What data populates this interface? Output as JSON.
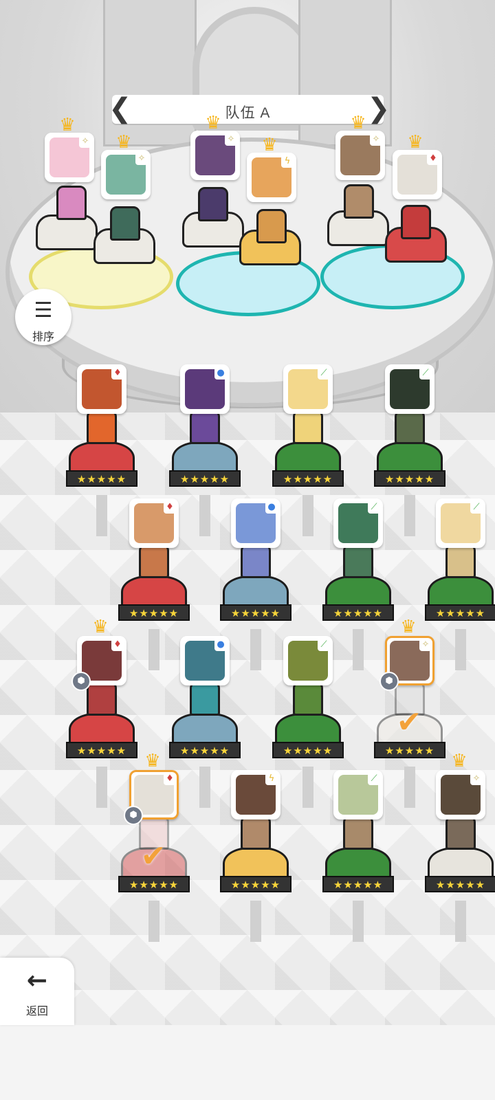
{
  "team": {
    "title": "队伍 A",
    "prev_arrow": "❮",
    "next_arrow": "❯"
  },
  "sort": {
    "label": "排序",
    "icon": "sort-icon"
  },
  "back": {
    "label": "返回",
    "icon": "back-arrow-icon"
  },
  "stars_text": "★★★★★",
  "check_glyph": "✔",
  "crown_glyph": "♛",
  "team_slots": [
    {
      "element": "✧",
      "element_color": "#c9b86a",
      "face": "#f5c6d6",
      "sprite": "#d98ac0",
      "pedestal": "white"
    },
    {
      "element": "✧",
      "element_color": "#c9b86a",
      "face": "#7ab5a1",
      "sprite": "#3f6b5b",
      "pedestal": "white"
    },
    {
      "element": "✧",
      "element_color": "#c9b86a",
      "face": "#6a4a7c",
      "sprite": "#4b3b6b",
      "pedestal": "white"
    },
    {
      "element": "ϟ",
      "element_color": "#e4b52c",
      "face": "#e7a55c",
      "sprite": "#d89a4d",
      "pedestal": "gold"
    },
    {
      "element": "✧",
      "element_color": "#c9b86a",
      "face": "#9a7a5e",
      "sprite": "#b08c6a",
      "pedestal": "white"
    },
    {
      "element": "♦",
      "element_color": "#d04040",
      "face": "#e4e0d8",
      "sprite": "#c43c3c",
      "pedestal": "red"
    }
  ],
  "roster": [
    {
      "element": "♦",
      "element_color": "#d04040",
      "face": "#c2562f",
      "sprite": "#e2662c",
      "pedestal": "red",
      "crown": false,
      "selected": false,
      "gear": false,
      "check": false
    },
    {
      "element": "●",
      "element_color": "#3a7fe0",
      "face": "#5b3a7a",
      "sprite": "#6b4a9a",
      "pedestal": "blue",
      "crown": false,
      "selected": false,
      "gear": false,
      "check": false
    },
    {
      "element": "⟋",
      "element_color": "#4caf50",
      "face": "#f3d88c",
      "sprite": "#efd37a",
      "pedestal": "green",
      "crown": false,
      "selected": false,
      "gear": false,
      "check": false
    },
    {
      "element": "⟋",
      "element_color": "#4caf50",
      "face": "#2d3a2d",
      "sprite": "#5a6a4a",
      "pedestal": "green",
      "crown": false,
      "selected": false,
      "gear": false,
      "check": false
    },
    {
      "element": "♦",
      "element_color": "#d04040",
      "face": "#d89a6a",
      "sprite": "#c8784a",
      "pedestal": "red",
      "crown": false,
      "selected": false,
      "gear": false,
      "check": false
    },
    {
      "element": "●",
      "element_color": "#3a7fe0",
      "face": "#7a98d8",
      "sprite": "#7a86c8",
      "pedestal": "blue",
      "crown": false,
      "selected": false,
      "gear": false,
      "check": false
    },
    {
      "element": "⟋",
      "element_color": "#4caf50",
      "face": "#3f7a5a",
      "sprite": "#4a7a5a",
      "pedestal": "green",
      "crown": false,
      "selected": false,
      "gear": false,
      "check": false
    },
    {
      "element": "⟋",
      "element_color": "#4caf50",
      "face": "#f0d8a0",
      "sprite": "#d8c08a",
      "pedestal": "green",
      "crown": false,
      "selected": false,
      "gear": false,
      "check": false
    },
    {
      "element": "♦",
      "element_color": "#d04040",
      "face": "#7a3a3a",
      "sprite": "#b04040",
      "pedestal": "red",
      "crown": true,
      "selected": false,
      "gear": true,
      "check": false
    },
    {
      "element": "●",
      "element_color": "#3a7fe0",
      "face": "#3f7a8a",
      "sprite": "#3a9aa0",
      "pedestal": "blue",
      "crown": false,
      "selected": false,
      "gear": false,
      "check": false
    },
    {
      "element": "⟋",
      "element_color": "#4caf50",
      "face": "#7a8a3a",
      "sprite": "#5a8a3a",
      "pedestal": "green",
      "crown": false,
      "selected": false,
      "gear": false,
      "check": false
    },
    {
      "element": "✧",
      "element_color": "#c9b86a",
      "face": "#8a6a5a",
      "sprite": "#d8d8d8",
      "pedestal": "white",
      "crown": true,
      "selected": true,
      "gear": true,
      "check": true
    },
    {
      "element": "♦",
      "element_color": "#d04040",
      "face": "#e4e0d8",
      "sprite": "#e8b0b0",
      "pedestal": "red",
      "crown": true,
      "selected": true,
      "gear": true,
      "check": true
    },
    {
      "element": "ϟ",
      "element_color": "#e4b52c",
      "face": "#6a4a3a",
      "sprite": "#b08a6a",
      "pedestal": "gold",
      "crown": false,
      "selected": false,
      "gear": false,
      "check": false
    },
    {
      "element": "⟋",
      "element_color": "#4caf50",
      "face": "#b8c89a",
      "sprite": "#a88a6a",
      "pedestal": "green",
      "crown": false,
      "selected": false,
      "gear": false,
      "check": false
    },
    {
      "element": "✧",
      "element_color": "#c9b86a",
      "face": "#5a4a3a",
      "sprite": "#7a6a5a",
      "pedestal": "white",
      "crown": true,
      "selected": false,
      "gear": false,
      "check": false
    }
  ]
}
